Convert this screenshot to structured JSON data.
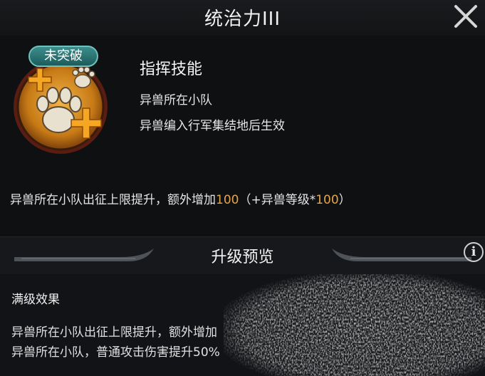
{
  "window": {
    "title": "统治力III",
    "close_icon": "close-x-icon"
  },
  "skill": {
    "status_badge": "未突破",
    "icon": "beast-paw-upgrade-icon",
    "name": "指挥技能",
    "condition_1": "异兽所在小队",
    "condition_2": "异兽编入行军集结地后生效",
    "description": {
      "prefix": "异兽所在小队出征上限提升，额外增加",
      "value_1": "100",
      "middle": "（+异兽等级*",
      "value_2": "100",
      "suffix": "）"
    }
  },
  "upgrade_preview": {
    "title": "升级预览",
    "info_icon": "info-icon"
  },
  "max_level": {
    "title": "满级效果",
    "line_1": "异兽所在小队出征上限提升，额外增加",
    "line_2": "异兽所在小队，普通攻击伤害提升50%"
  },
  "colors": {
    "highlight": "#e5a54a",
    "badge": "#2d7775",
    "background": "#101114"
  }
}
